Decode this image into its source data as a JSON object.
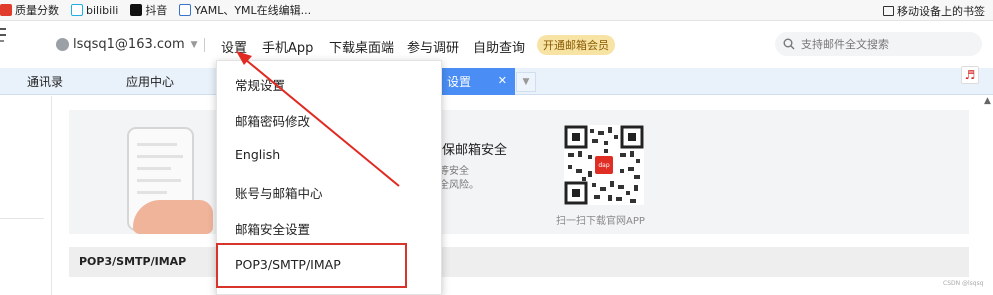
{
  "bookmarks": {
    "items": [
      {
        "label": "质量分数",
        "color": "#e03b2b"
      },
      {
        "label": "bilibili",
        "color": "#23ade5"
      },
      {
        "label": "抖音",
        "color": "#111111"
      },
      {
        "label": "YAML、YML在线编辑...",
        "color": "#3a73c9"
      }
    ],
    "mobile_label": "移动设备上的书签"
  },
  "header": {
    "account": "lsqsq1@163.com",
    "nav": [
      "设置",
      "手机App",
      "下载桌面端",
      "参与调研",
      "自助查询"
    ],
    "vip_label": "开通邮箱会员",
    "search_placeholder": "支持邮件全文搜索"
  },
  "tabs": {
    "items": [
      "通讯录",
      "应用中心"
    ],
    "active": "设置"
  },
  "dropdown": {
    "items": [
      "常规设置",
      "邮箱密码修改",
      "English",
      "账号与邮箱中心",
      "邮箱安全设置",
      "POP3/SMTP/IMAP"
    ]
  },
  "content": {
    "security_title": "确保邮箱安全",
    "security_line1": "证等安全",
    "security_line2": "安全风险。",
    "qr_badge": "dap",
    "qr_caption": "扫一扫下载官网APP",
    "pop_section": "POP3/SMTP/IMAP",
    "watermark": "CSDN @lsqsq"
  },
  "colors": {
    "accent": "#4a8ef5",
    "highlight": "#d7342b",
    "vip": "#f7e3a4"
  }
}
